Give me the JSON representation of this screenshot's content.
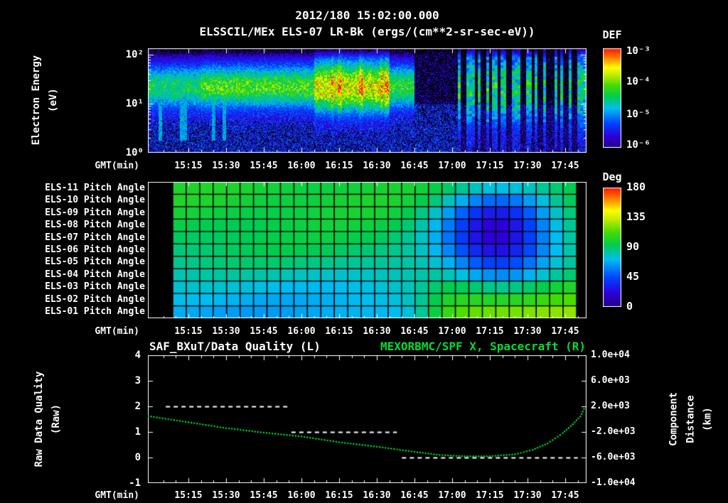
{
  "header": {
    "line1": "2012/180 15:02:00.000",
    "line2": "ELSSCIL/MEx ELS-07 LR-Bk  (ergs/(cm**2-sr-sec-eV))"
  },
  "axes": {
    "gmt_label": "GMT(min)",
    "time_ticks": [
      "15:15",
      "15:30",
      "15:45",
      "16:00",
      "16:15",
      "16:30",
      "16:45",
      "17:00",
      "17:15",
      "17:30",
      "17:45"
    ]
  },
  "spectrogram": {
    "ylabel": "Electron Energy\n(eV)",
    "yticks": [
      "10²",
      "10¹",
      "10⁰"
    ],
    "colorbar_title": "DEF",
    "colorbar_labels": [
      "10⁻³",
      "10⁻⁴",
      "10⁻⁵",
      "10⁻⁶"
    ]
  },
  "pitch": {
    "row_labels": [
      "ELS-11 Pitch Angle",
      "ELS-10 Pitch Angle",
      "ELS-09 Pitch Angle",
      "ELS-08 Pitch Angle",
      "ELS-07 Pitch Angle",
      "ELS-06 Pitch Angle",
      "ELS-05 Pitch Angle",
      "ELS-04 Pitch Angle",
      "ELS-03 Pitch Angle",
      "ELS-02 Pitch Angle",
      "ELS-01 Pitch Angle"
    ],
    "colorbar_title": "Deg",
    "colorbar_labels": [
      "180",
      "135",
      "90",
      "45",
      "0"
    ]
  },
  "bottom": {
    "title_left": "SAF_BXuT/Data Quality (L)",
    "title_right": "MEXORBMC/SPF X, Spacecraft (R)",
    "ylabel_left": "Raw Data Quality\n(Raw)",
    "ylabel_right": "Component Distance\n(km)",
    "yticks_left": [
      "4",
      "3",
      "2",
      "1",
      "0",
      "-1"
    ],
    "yticks_right": [
      "1.0e+04",
      "6.0e+03",
      "2.0e+03",
      "-2.0e+03",
      "-6.0e+03",
      "-1.0e+04"
    ]
  },
  "colors": {
    "background": "#000000",
    "text": "#ffffff",
    "green": "#00dd33"
  },
  "chart_data": [
    {
      "type": "heatmap",
      "name": "electron-energy-spectrogram",
      "title": "ELSSCIL/MEx ELS-07 LR-Bk",
      "units": "ergs/(cm**2-sr-sec-eV)",
      "xlabel": "GMT(min)",
      "ylabel": "Electron Energy (eV)",
      "x_range_gmt": [
        "14:59",
        "17:53"
      ],
      "y_scale": "log",
      "y_range_ev": [
        1,
        140
      ],
      "colorbar": {
        "label": "DEF",
        "min": 1e-06,
        "max": 0.001,
        "tick_labels": [
          "10⁻³",
          "10⁻⁴",
          "10⁻⁵",
          "10⁻⁶"
        ]
      },
      "render": {
        "band_center_log10ev": 1.35,
        "band_sigma_log10": 0.34,
        "intensity_timeline": [
          {
            "t0": -1,
            "t1": 20,
            "amp": 0.5
          },
          {
            "t0": 20,
            "t1": 65,
            "amp": 0.58
          },
          {
            "t0": 65,
            "t1": 95,
            "amp": 0.74
          },
          {
            "t0": 95,
            "t1": 105,
            "amp": 0.55
          }
        ],
        "stripes": {
          "t0": 122,
          "t1": 174,
          "fraction": 0.5,
          "amp": 0.62
        },
        "low_energy_noise_amp": 0.3,
        "early_streaks_until": 32
      }
    },
    {
      "type": "heatmap",
      "name": "pitch-angle-panel",
      "rows": [
        "ELS-11 Pitch Angle",
        "ELS-10 Pitch Angle",
        "ELS-09 Pitch Angle",
        "ELS-08 Pitch Angle",
        "ELS-07 Pitch Angle",
        "ELS-06 Pitch Angle",
        "ELS-05 Pitch Angle",
        "ELS-04 Pitch Angle",
        "ELS-03 Pitch Angle",
        "ELS-02 Pitch Angle",
        "ELS-01 Pitch Angle"
      ],
      "colorbar": {
        "label": "Deg",
        "min": 0,
        "max": 180,
        "ticks": [
          180,
          135,
          90,
          45,
          0
        ]
      },
      "x_range_gmt": [
        "15:11",
        "17:42"
      ],
      "columns": 30,
      "base_deg": [
        100,
        100,
        98,
        96,
        94,
        91,
        87,
        80,
        74,
        70,
        67
      ],
      "dip": {
        "center_gmt": "17:18",
        "sigma_min": 16,
        "depth_deg": [
          25,
          45,
          65,
          75,
          78,
          72,
          58,
          40,
          22,
          8,
          0
        ]
      },
      "rise": {
        "start_gmt": "16:52",
        "amount_deg": [
          0,
          0,
          0,
          0,
          2,
          5,
          10,
          20,
          35,
          45,
          55
        ]
      }
    },
    {
      "type": "line",
      "name": "quality-and-spacecraft-x",
      "xlabel": "GMT(min)",
      "ylim_left": [
        -1,
        4
      ],
      "ylim_right": [
        -10000,
        10000
      ],
      "series": [
        {
          "name": "SAF_BXuT/Data Quality (L)",
          "axis": "left",
          "style": "dashed",
          "color": "#ffffff",
          "segments": [
            {
              "t0": "15:06",
              "t1": "15:55",
              "value": 2
            },
            {
              "t0": "15:56",
              "t1": "16:38",
              "value": 1
            },
            {
              "t0": "16:40",
              "t1": "17:50",
              "value": 0
            }
          ]
        },
        {
          "name": "MEXORBMC/SPF X, Spacecraft (R)",
          "axis": "right",
          "style": "dotted",
          "color": "#00dd33",
          "points_t_min_after_1500": [
            -1,
            15,
            30,
            45,
            60,
            75,
            90,
            105,
            115,
            125,
            135,
            145,
            152,
            158,
            164,
            168,
            171,
            173
          ],
          "points_x_km": [
            480,
            -480,
            -1400,
            -2100,
            -2700,
            -3600,
            -4300,
            -5100,
            -5600,
            -5800,
            -5800,
            -5500,
            -4800,
            -3800,
            -2200,
            -800,
            400,
            2000
          ]
        }
      ]
    }
  ]
}
